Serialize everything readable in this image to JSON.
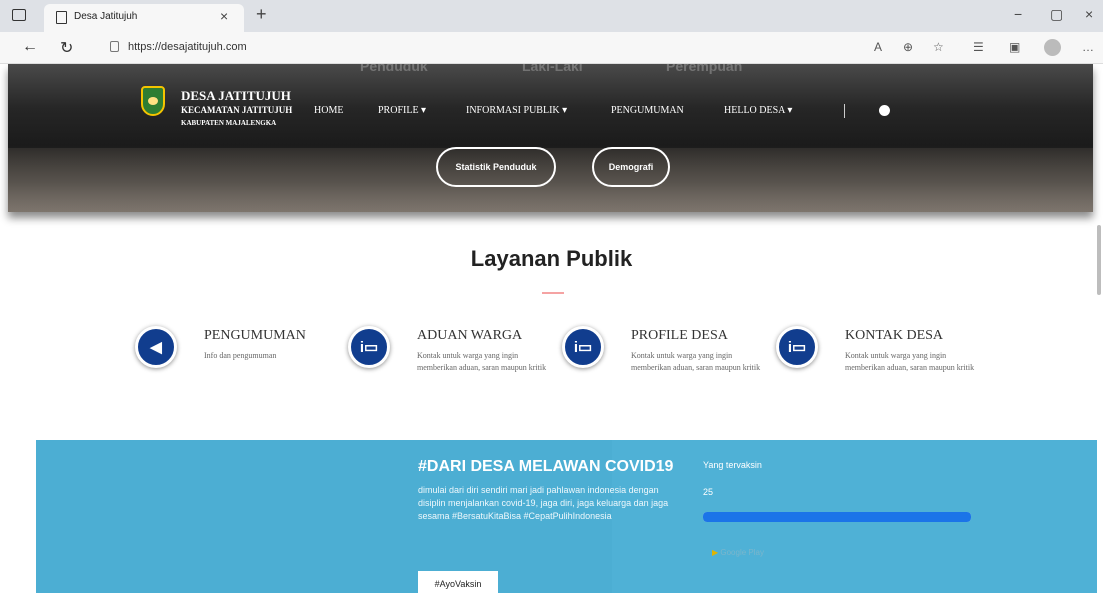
{
  "browser": {
    "tab_title": "Desa Jatitujuh",
    "url": "https://desajatitujuh.com"
  },
  "hero": {
    "ghost_labels": [
      "Penduduk",
      "Laki-Laki",
      "Perempuan"
    ],
    "brand": {
      "title": "DESA JATITUJUH",
      "subtitle1": "KECAMATAN JATITUJUH",
      "subtitle2": "KABUPATEN MAJALENGKA"
    },
    "menu": [
      "HOME",
      "PROFILE ▾",
      "INFORMASI PUBLIK ▾",
      "PENGUMUMAN",
      "HELLO DESA ▾"
    ],
    "buttons": {
      "statistik": "Statistik Penduduk",
      "demografi": "Demografi"
    }
  },
  "layanan": {
    "title": "Layanan Publik",
    "items": [
      {
        "title": "PENGUMUMAN",
        "desc": "Info dan pengumuman",
        "icon": "megaphone-icon"
      },
      {
        "title": "ADUAN WARGA",
        "desc": "Kontak untuk warga yang ingin memberikan aduan, saran maupun kritik",
        "icon": "info-board-icon"
      },
      {
        "title": "PROFILE DESA",
        "desc": "Kontak untuk warga yang ingin memberikan aduan, saran maupun kritik",
        "icon": "info-board-icon"
      },
      {
        "title": "KONTAK DESA",
        "desc": "Kontak untuk warga yang ingin memberikan aduan, saran maupun kritik",
        "icon": "info-board-icon"
      }
    ]
  },
  "covid": {
    "title": "#DARI DESA MELAWAN COVID19",
    "text": "dimulai dari diri sendiri mari jadi pahlawan indonesia dengan disiplin menjalankan covid-19, jaga diri, jaga keluarga dan jaga sesama #BersatuKitaBisa #CepatPulihIndonesia",
    "button": "#AyoVaksin",
    "vax_label": "Yang tervaksin",
    "vax_count": "25",
    "vax_progress": 1.0,
    "store": "Google Play"
  },
  "colors": {
    "accent_blue": "#113d8e",
    "covid_bg": "#4fb1d6",
    "progress": "#1b74e8"
  }
}
